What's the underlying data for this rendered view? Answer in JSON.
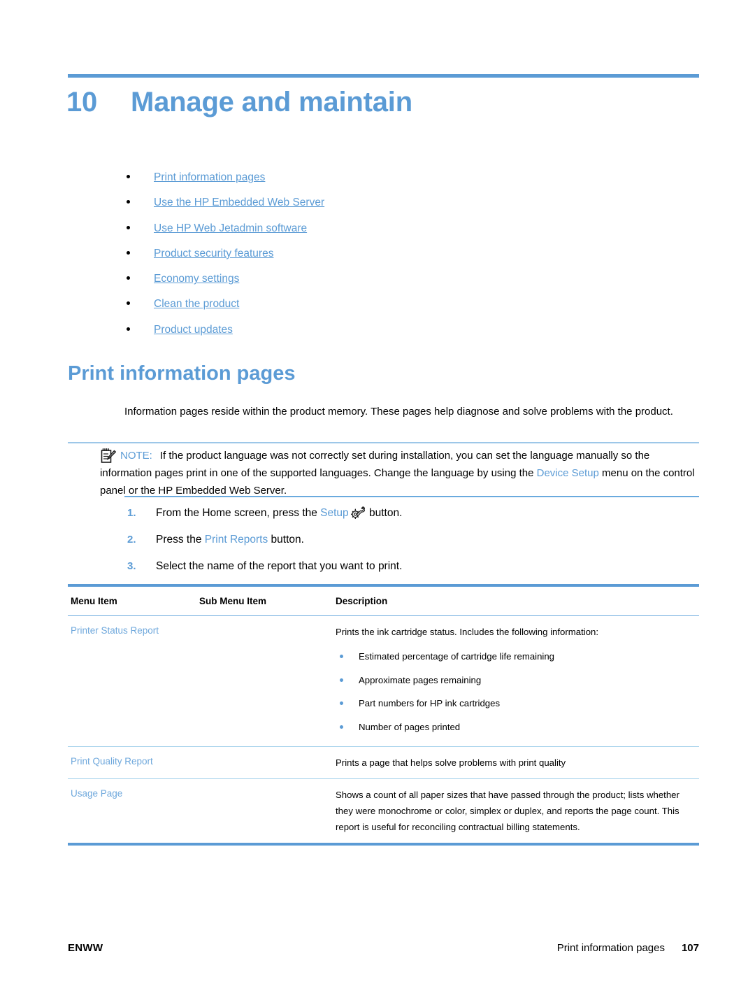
{
  "chapter": {
    "number": "10",
    "title": "Manage and maintain"
  },
  "toc": {
    "items": [
      {
        "label": "Print information pages"
      },
      {
        "label": "Use the HP Embedded Web Server"
      },
      {
        "label": "Use HP Web Jetadmin software"
      },
      {
        "label": "Product security features"
      },
      {
        "label": "Economy settings"
      },
      {
        "label": "Clean the product"
      },
      {
        "label": "Product updates"
      }
    ]
  },
  "section": {
    "heading": "Print information pages",
    "intro": "Information pages reside within the product memory. These pages help diagnose and solve problems with the product."
  },
  "note": {
    "icon": "note-pad-pencil-icon",
    "label": "NOTE:",
    "text_part1": "If the product language was not correctly set during installation, you can set the language manually so the information pages print in one of the supported languages. Change the language by using the ",
    "ui_term": "Device Setup",
    "text_part2": " menu on the control panel or the HP Embedded Web Server."
  },
  "steps": [
    {
      "number": "1.",
      "text_part1": "From the Home screen, press the ",
      "ui_term": "Setup",
      "icon": "wrench-gear-icon",
      "text_part2": " button."
    },
    {
      "number": "2.",
      "text_part1": "Press the ",
      "ui_term": "Print Reports",
      "text_part2": " button."
    },
    {
      "number": "3.",
      "text_part1": "Select the name of the report that you want to print.",
      "ui_term": "",
      "text_part2": ""
    }
  ],
  "table": {
    "headers": {
      "menu_item": "Menu Item",
      "sub_menu_item": "Sub Menu Item",
      "description": "Description"
    },
    "rows": [
      {
        "menu_item": "Printer Status Report",
        "sub_menu_item": "",
        "description": "Prints the ink cartridge status. Includes the following information:",
        "bullets": [
          "Estimated percentage of cartridge life remaining",
          "Approximate pages remaining",
          "Part numbers for HP ink cartridges",
          "Number of pages printed"
        ]
      },
      {
        "menu_item": "Print Quality Report",
        "sub_menu_item": "",
        "description": "Prints a page that helps solve problems with print quality",
        "bullets": []
      },
      {
        "menu_item": "Usage Page",
        "sub_menu_item": "",
        "description": "Shows a count of all paper sizes that have passed through the product; lists whether they were monochrome or color, simplex or duplex, and reports the page count. This report is useful for reconciling contractual billing statements.",
        "bullets": []
      }
    ]
  },
  "footer": {
    "left": "ENWW",
    "right_title": "Print information pages",
    "page_number": "107"
  },
  "colors": {
    "accent_blue": "#5b9bd5",
    "link_blue": "#6fa8dc",
    "rule_light": "#a8d3ec",
    "text_black": "#000000"
  }
}
